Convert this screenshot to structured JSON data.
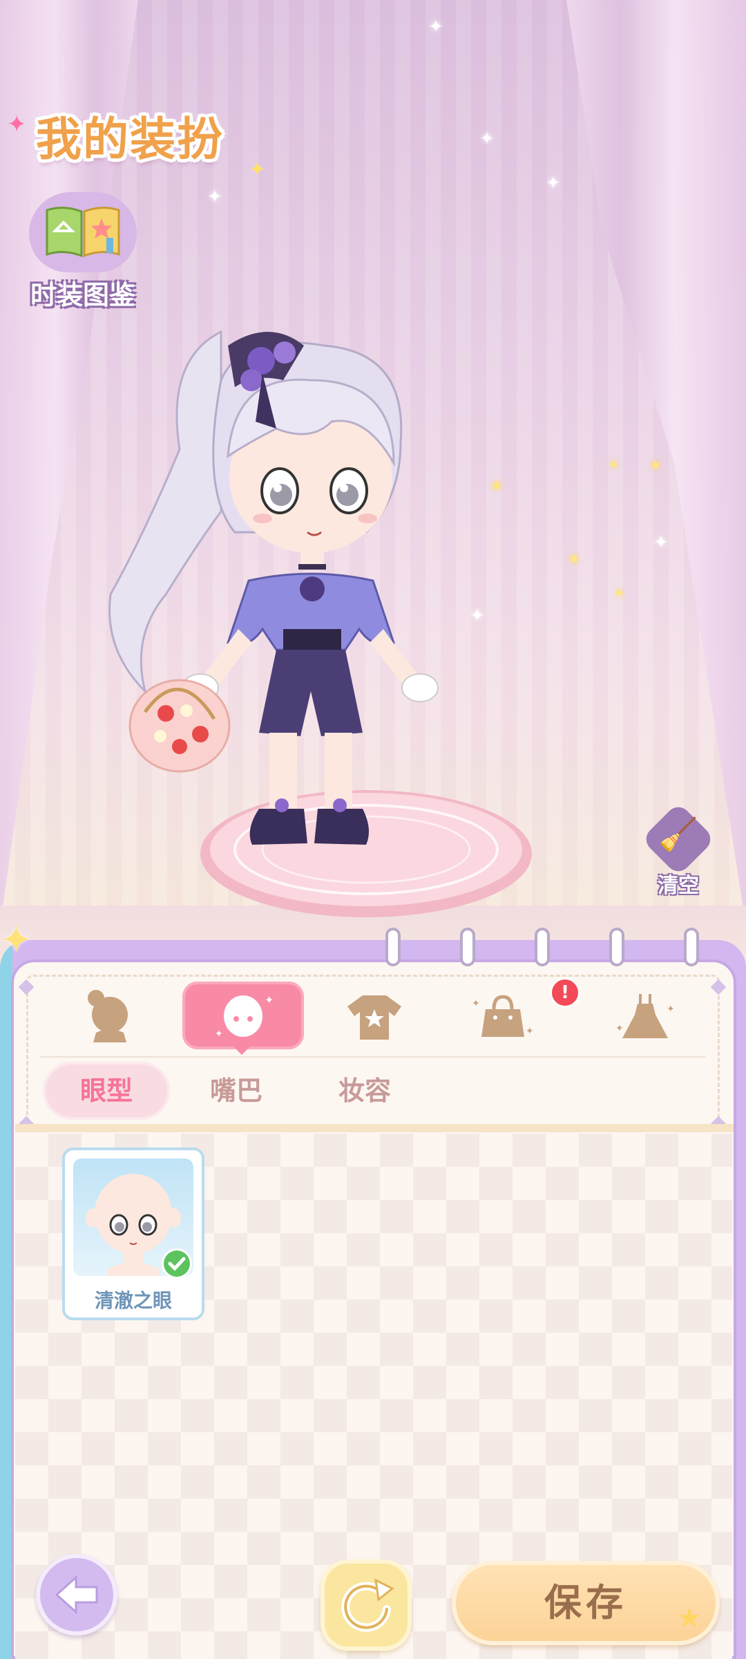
{
  "header": {
    "title": "我的装扮",
    "catalog_label": "时装图鉴"
  },
  "stage": {
    "clear_label": "清空"
  },
  "tabs": [
    {
      "id": "hair",
      "icon": "hair-silhouette-icon",
      "active": false
    },
    {
      "id": "face",
      "icon": "face-icon",
      "active": true
    },
    {
      "id": "top",
      "icon": "shirt-icon",
      "active": false
    },
    {
      "id": "accessory",
      "icon": "handbag-icon",
      "active": false,
      "badge": "!"
    },
    {
      "id": "dress",
      "icon": "dress-icon",
      "active": false
    }
  ],
  "subtabs": [
    "眼型",
    "嘴巴",
    "妆容"
  ],
  "active_subtab": "眼型",
  "items": [
    {
      "name": "清澈之眼",
      "selected": true
    }
  ],
  "footer": {
    "save_label": "保存"
  },
  "colors": {
    "title_orange": "#f0a14b",
    "active_tab_pink": "#f88aa6",
    "panel_border_lavender": "#c6a9e3",
    "save_button": "#fcd296",
    "badge_red": "#f24a57"
  }
}
